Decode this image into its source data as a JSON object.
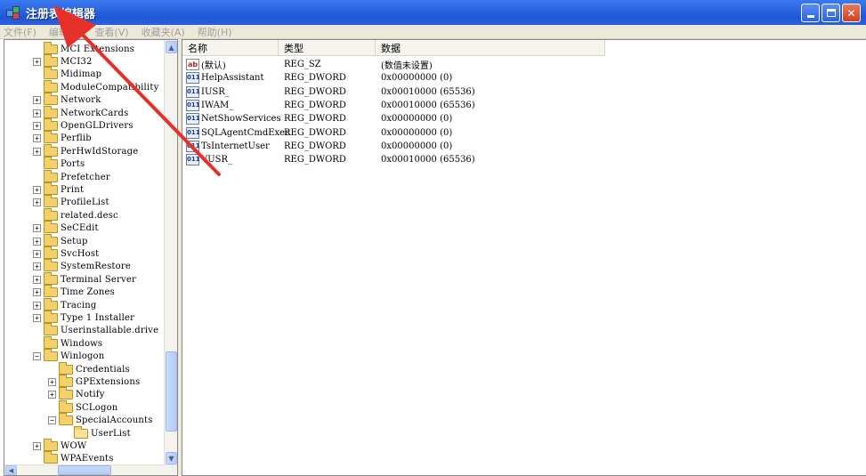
{
  "window": {
    "title": "注册表编辑器",
    "buttons": [
      "minimize",
      "maximize",
      "close"
    ]
  },
  "menu": [
    {
      "label": "文件(F)"
    },
    {
      "label": "编辑(E)"
    },
    {
      "label": "查看(V)"
    },
    {
      "label": "收藏夹(A)"
    },
    {
      "label": "帮助(H)"
    }
  ],
  "tree": [
    {
      "label": "MCI Extensions",
      "level": 0,
      "expander": "none"
    },
    {
      "label": "MCI32",
      "level": 0,
      "expander": "plus"
    },
    {
      "label": "Midimap",
      "level": 0,
      "expander": "none"
    },
    {
      "label": "ModuleCompatibility",
      "level": 0,
      "expander": "none"
    },
    {
      "label": "Network",
      "level": 0,
      "expander": "plus"
    },
    {
      "label": "NetworkCards",
      "level": 0,
      "expander": "plus"
    },
    {
      "label": "OpenGLDrivers",
      "level": 0,
      "expander": "plus"
    },
    {
      "label": "Perflib",
      "level": 0,
      "expander": "plus"
    },
    {
      "label": "PerHwIdStorage",
      "level": 0,
      "expander": "plus"
    },
    {
      "label": "Ports",
      "level": 0,
      "expander": "none"
    },
    {
      "label": "Prefetcher",
      "level": 0,
      "expander": "none"
    },
    {
      "label": "Print",
      "level": 0,
      "expander": "plus"
    },
    {
      "label": "ProfileList",
      "level": 0,
      "expander": "plus"
    },
    {
      "label": "related.desc",
      "level": 0,
      "expander": "none"
    },
    {
      "label": "SeCEdit",
      "level": 0,
      "expander": "plus"
    },
    {
      "label": "Setup",
      "level": 0,
      "expander": "plus"
    },
    {
      "label": "SvcHost",
      "level": 0,
      "expander": "plus"
    },
    {
      "label": "SystemRestore",
      "level": 0,
      "expander": "plus"
    },
    {
      "label": "Terminal Server",
      "level": 0,
      "expander": "plus"
    },
    {
      "label": "Time Zones",
      "level": 0,
      "expander": "plus"
    },
    {
      "label": "Tracing",
      "level": 0,
      "expander": "plus"
    },
    {
      "label": "Type 1 Installer",
      "level": 0,
      "expander": "plus"
    },
    {
      "label": "Userinstallable.drive",
      "level": 0,
      "expander": "none"
    },
    {
      "label": "Windows",
      "level": 0,
      "expander": "none"
    },
    {
      "label": "Winlogon",
      "level": 0,
      "expander": "minus"
    },
    {
      "label": "Credentials",
      "level": 1,
      "expander": "none"
    },
    {
      "label": "GPExtensions",
      "level": 1,
      "expander": "plus"
    },
    {
      "label": "Notify",
      "level": 1,
      "expander": "plus"
    },
    {
      "label": "SCLogon",
      "level": 1,
      "expander": "none"
    },
    {
      "label": "SpecialAccounts",
      "level": 1,
      "expander": "minus"
    },
    {
      "label": "UserList",
      "level": 2,
      "expander": "none",
      "open": true
    },
    {
      "label": "WOW",
      "level": 0,
      "expander": "plus"
    },
    {
      "label": "WPAEvents",
      "level": 0,
      "expander": "none"
    }
  ],
  "values": {
    "columns": [
      {
        "label": "名称"
      },
      {
        "label": "类型"
      },
      {
        "label": "数据"
      }
    ],
    "rows": [
      {
        "icon": "string-value-icon",
        "icon_text": "ab",
        "name": "(默认)",
        "type": "REG_SZ",
        "data": "(数值未设置)"
      },
      {
        "icon": "binary-value-icon",
        "icon_text": "011",
        "name": "HelpAssistant",
        "type": "REG_DWORD",
        "data": "0x00000000  (0)"
      },
      {
        "icon": "binary-value-icon",
        "icon_text": "011",
        "name": "IUSR_",
        "type": "REG_DWORD",
        "data": "0x00010000  (65536)"
      },
      {
        "icon": "binary-value-icon",
        "icon_text": "011",
        "name": "IWAM_",
        "type": "REG_DWORD",
        "data": "0x00010000  (65536)"
      },
      {
        "icon": "binary-value-icon",
        "icon_text": "011",
        "name": "NetShowServices",
        "type": "REG_DWORD",
        "data": "0x00000000  (0)"
      },
      {
        "icon": "binary-value-icon",
        "icon_text": "011",
        "name": "SQLAgentCmdExec",
        "type": "REG_DWORD",
        "data": "0x00000000  (0)"
      },
      {
        "icon": "binary-value-icon",
        "icon_text": "011",
        "name": "TsInternetUser",
        "type": "REG_DWORD",
        "data": "0x00000000  (0)"
      },
      {
        "icon": "binary-value-icon",
        "icon_text": "011",
        "name": "VUSR_",
        "type": "REG_DWORD",
        "data": "0x00010000  (65536)"
      }
    ]
  },
  "colors": {
    "titlebar": "#2a63e0",
    "annotation_arrow": "#e8302a",
    "menu_text": "#a0a0a0",
    "folder": "#f3d16a"
  }
}
